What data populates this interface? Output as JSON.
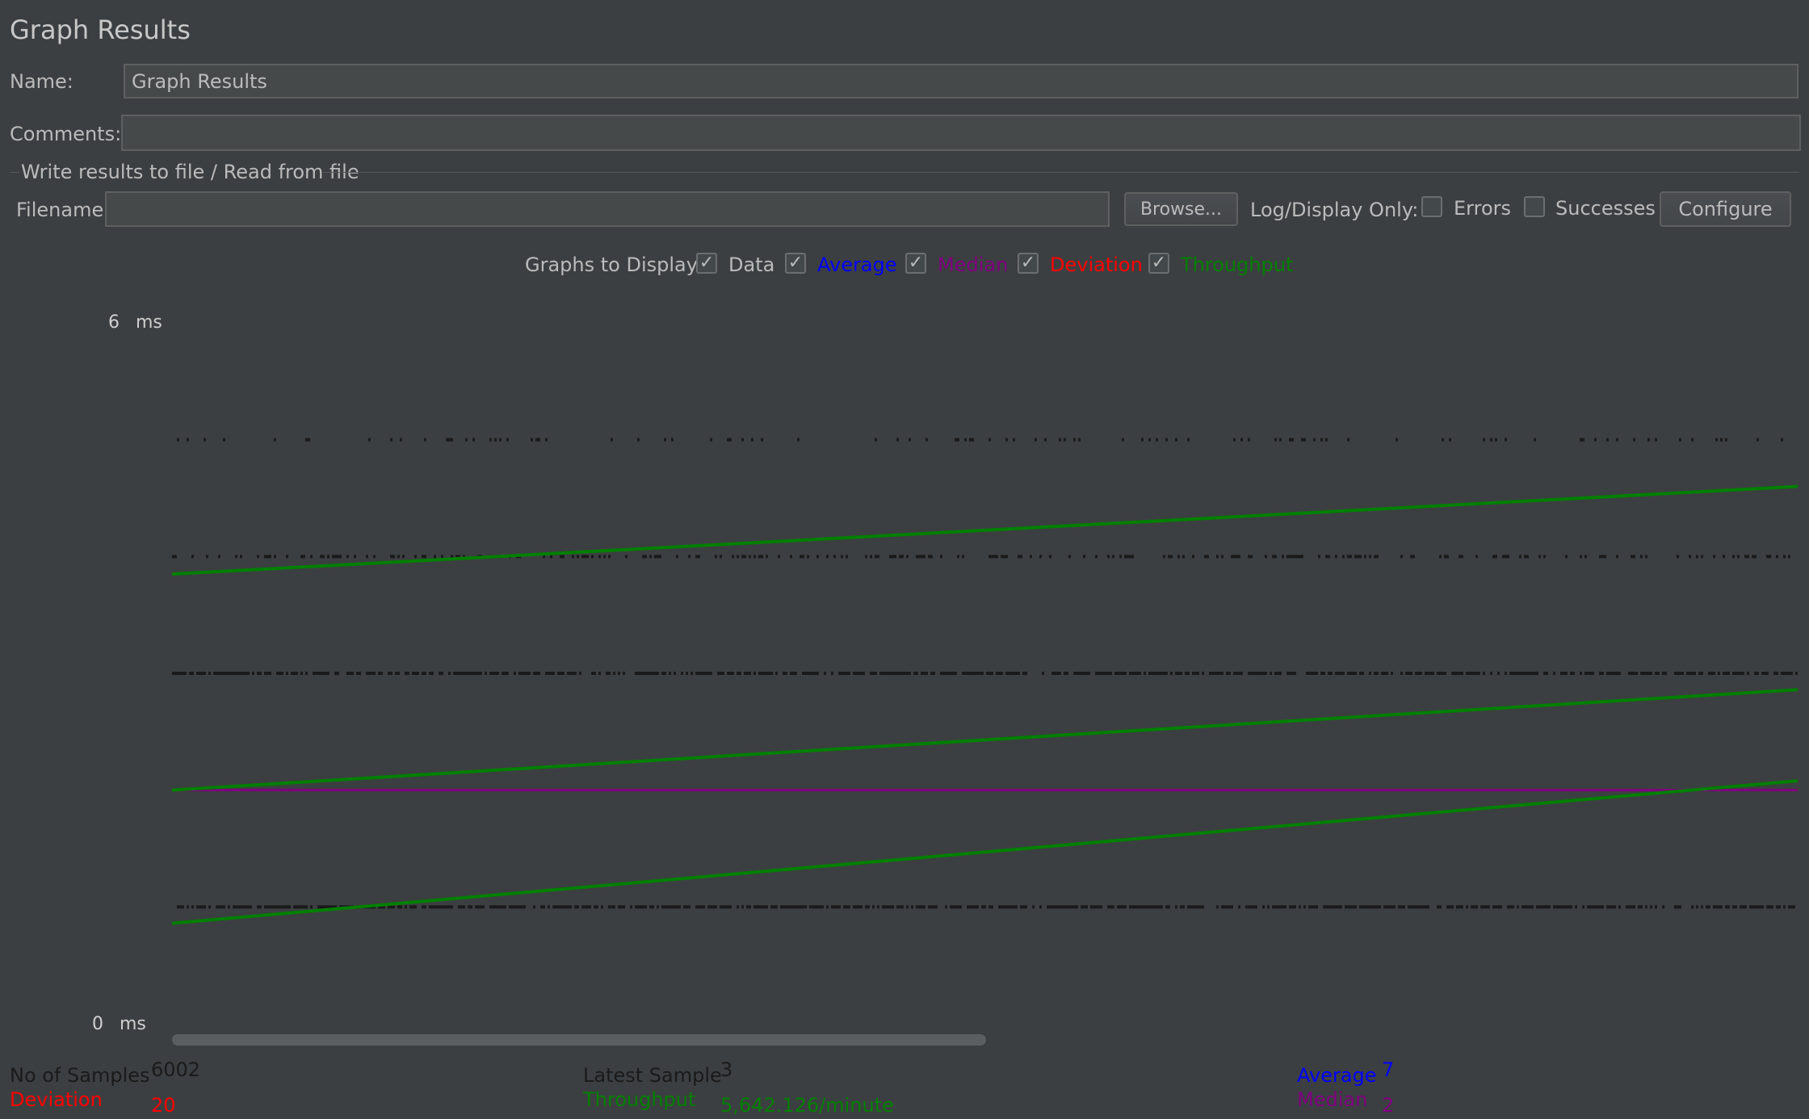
{
  "title": "Graph Results",
  "name": {
    "label": "Name:",
    "value": "Graph Results"
  },
  "comments": {
    "label": "Comments:",
    "value": ""
  },
  "file_section": {
    "legend": "Write results to file / Read from file",
    "filename_label": "Filename",
    "filename_value": "",
    "browse": "Browse...",
    "log_display_only": "Log/Display Only:",
    "errors": "Errors",
    "errors_checked": false,
    "successes": "Successes",
    "successes_checked": false,
    "configure": "Configure"
  },
  "graphs": {
    "label": "Graphs to Display",
    "options": [
      {
        "label": "Data",
        "checked": true,
        "color": "#1a1a1a"
      },
      {
        "label": "Average",
        "checked": true,
        "color": "#0000ff"
      },
      {
        "label": "Median",
        "checked": true,
        "color": "#800080"
      },
      {
        "label": "Deviation",
        "checked": true,
        "color": "#ff0000"
      },
      {
        "label": "Throughput",
        "checked": true,
        "color": "#008000"
      }
    ]
  },
  "chart_data": {
    "type": "line",
    "y_max_label": "6",
    "y_min_label": "0",
    "y_unit": "ms",
    "ylim": [
      0,
      6
    ],
    "series": [
      {
        "name": "Throughput",
        "color": "#008000",
        "segments": [
          [
            0.0,
            0.86
          ],
          [
            0.0,
            2.0
          ],
          [
            0.0,
            3.85
          ]
        ],
        "end": [
          2.08,
          2.86,
          4.6
        ]
      },
      {
        "name": "Median",
        "color": "#800080",
        "values": [
          2.0,
          2.0
        ]
      },
      {
        "name": "Data",
        "color": "#1a1a1a",
        "levels": [
          5.0,
          4.0,
          3.0,
          1.0
        ]
      }
    ]
  },
  "stats": {
    "samples_label": "No of Samples",
    "samples_value": "6002",
    "latest_label": "Latest Sample",
    "latest_value": "3",
    "average_label": "Average",
    "average_value": "7",
    "deviation_label": "Deviation",
    "deviation_value": "20",
    "throughput_label": "Throughput",
    "throughput_value": "5,642.126/minute",
    "median_label": "Median",
    "median_value": "2"
  },
  "colors": {
    "background": "#3c3f41",
    "field": "#45494a",
    "average": "#0000ff",
    "median": "#800080",
    "deviation": "#ff0000",
    "throughput": "#008000",
    "data": "#1a1a1a"
  }
}
